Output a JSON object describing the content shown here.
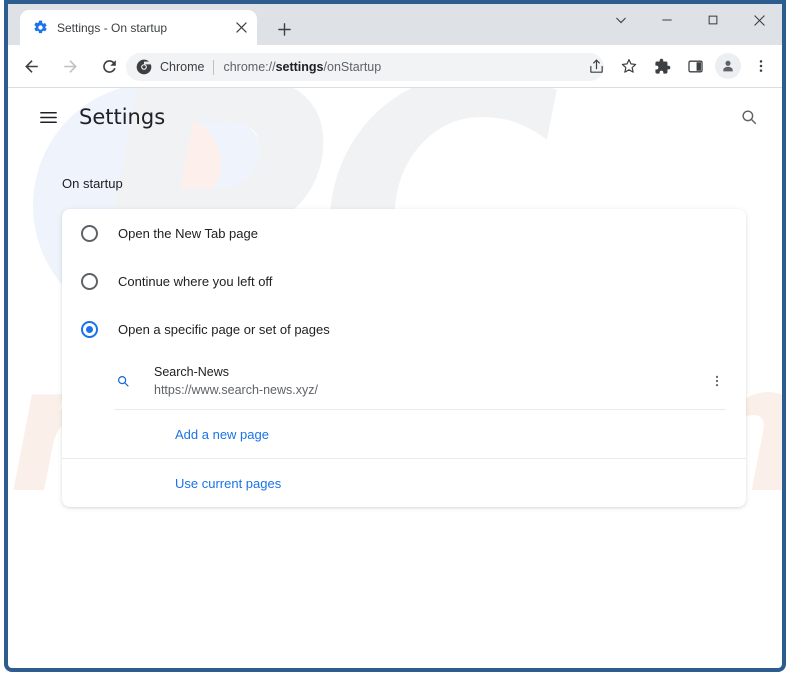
{
  "browser": {
    "window_controls": [
      {
        "name": "tab-search",
        "icon": "chevron-down-icon",
        "label": "Search tabs"
      },
      {
        "name": "minimize",
        "icon": "minimize-icon",
        "label": "Minimize"
      },
      {
        "name": "maximize",
        "icon": "maximize-icon",
        "label": "Maximize"
      },
      {
        "name": "close",
        "icon": "close-icon",
        "label": "Close"
      }
    ],
    "tab": {
      "title": "Settings - On startup",
      "favicon": "settings-gear-icon",
      "close_icon": "close-icon"
    },
    "new_tab_button": {
      "icon": "plus-icon",
      "label": "New tab"
    },
    "nav": {
      "back": {
        "icon": "arrow-back-icon",
        "label": "Back"
      },
      "forward": {
        "icon": "arrow-forward-icon",
        "label": "Forward"
      },
      "reload": {
        "icon": "reload-icon",
        "label": "Reload"
      }
    },
    "omnibox": {
      "site_icon": "chrome-logo-icon",
      "site_label": "Chrome",
      "url_prefix": "chrome://",
      "url_bold": "settings",
      "url_suffix": "/onStartup",
      "full_url": "chrome://settings/onStartup"
    },
    "toolbar_actions": [
      {
        "name": "share-button",
        "icon": "share-icon"
      },
      {
        "name": "bookmark-button",
        "icon": "star-icon"
      },
      {
        "name": "extensions-button",
        "icon": "puzzle-icon"
      },
      {
        "name": "side-panel-button",
        "icon": "side-panel-icon"
      },
      {
        "name": "profile-button",
        "icon": "person-icon"
      },
      {
        "name": "chrome-menu-button",
        "icon": "more-vertical-icon"
      }
    ]
  },
  "settings": {
    "menu_icon": "hamburger-icon",
    "title": "Settings",
    "search_icon": "search-icon",
    "section_title": "On startup",
    "options": [
      {
        "label": "Open the New Tab page",
        "selected": false
      },
      {
        "label": "Continue where you left off",
        "selected": false
      },
      {
        "label": "Open a specific page or set of pages",
        "selected": true
      }
    ],
    "startup_page": {
      "favicon": "search-magnifier-icon",
      "name": "Search-News",
      "url": "https://www.search-news.xyz/",
      "menu_icon": "more-vertical-icon"
    },
    "add_new_page_label": "Add a new page",
    "use_current_pages_label": "Use current pages"
  },
  "watermark": {
    "primary_text": "PC",
    "secondary_text": "risk.com",
    "primary_color": "#f1f2f3",
    "secondary_color": "#fbf0e9"
  },
  "colors": {
    "accent": "#1a73e8",
    "window_border": "#2d5c8f",
    "tabstrip": "#dee1e6",
    "omnibox_bg": "#f1f3f4",
    "text_primary": "#202124",
    "text_secondary": "#5f6368"
  }
}
